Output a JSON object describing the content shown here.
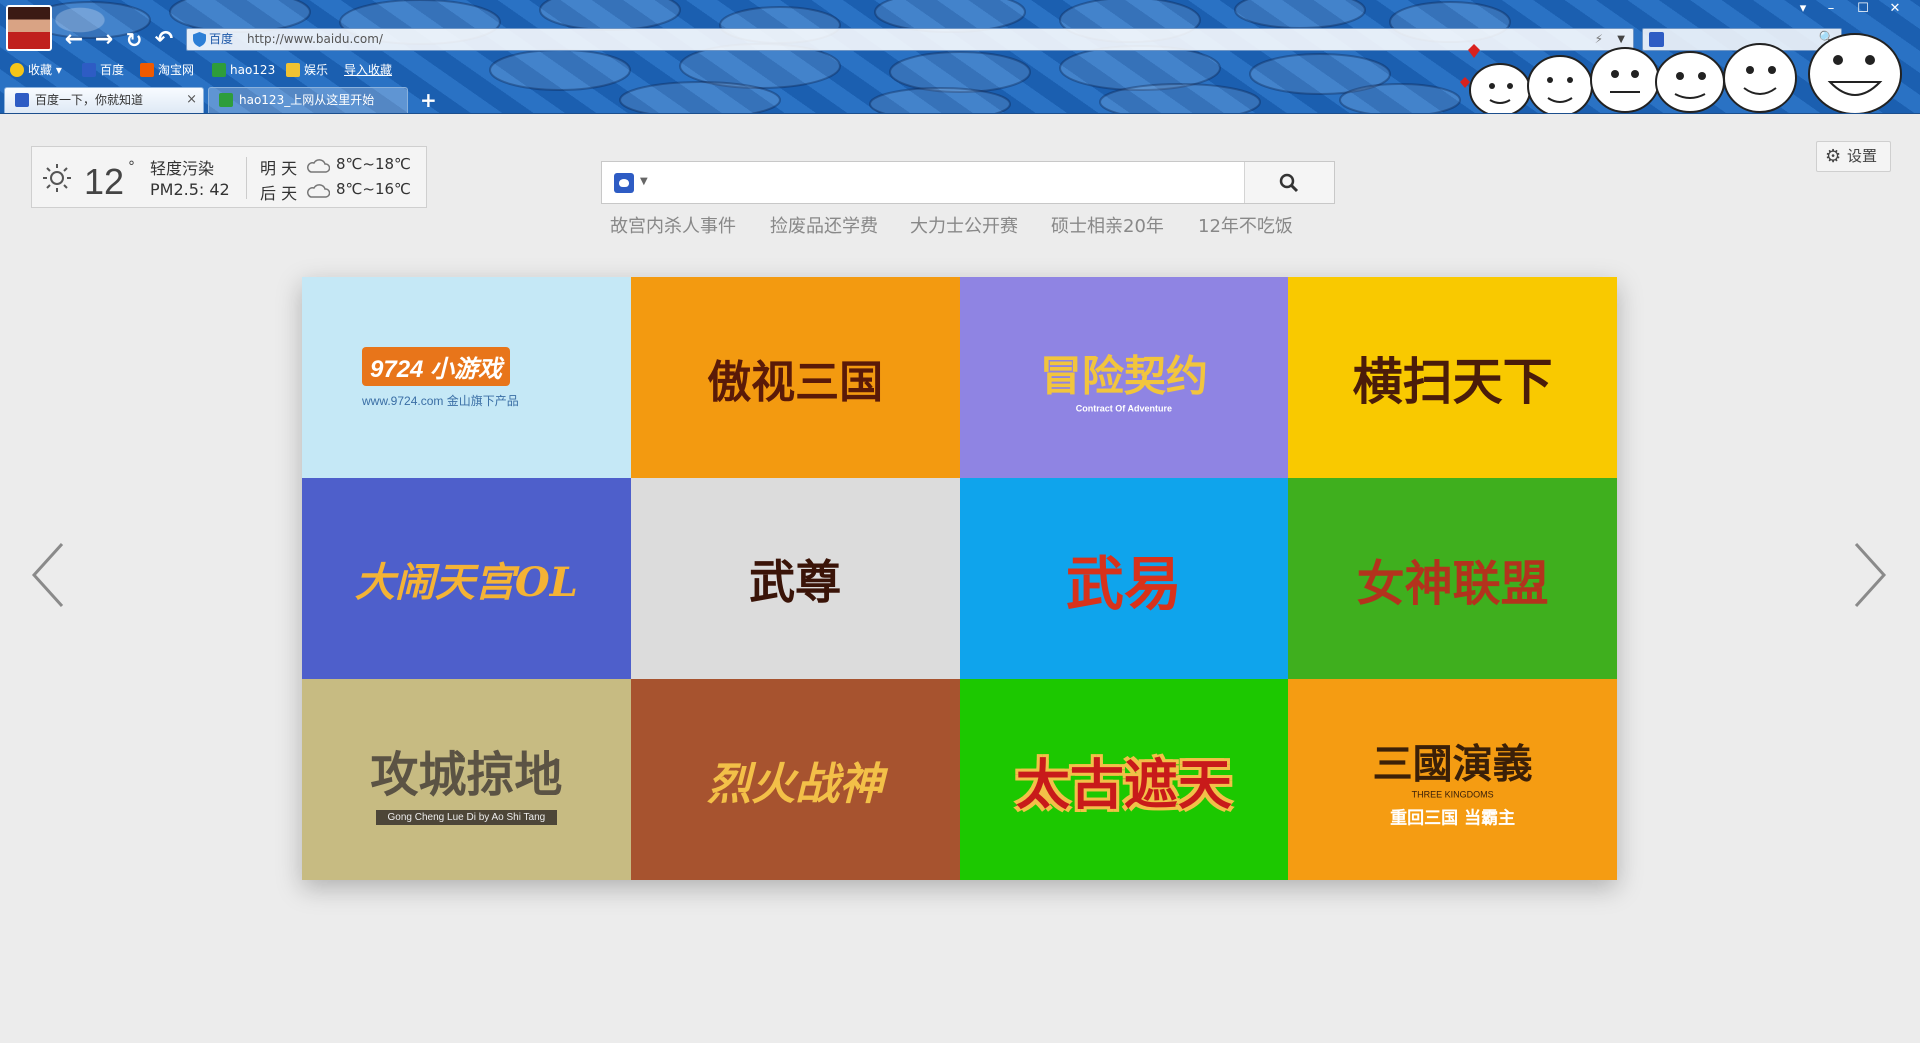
{
  "browser": {
    "address": {
      "site_label": "百度",
      "url": "http://www.baidu.com/"
    },
    "bookmarks": [
      {
        "label": "收藏",
        "color": "#f5c518"
      },
      {
        "label": "百度",
        "color": "#2e5cc4"
      },
      {
        "label": "淘宝网",
        "color": "#f05a00"
      },
      {
        "label": "hao123",
        "color": "#2e9d3b"
      },
      {
        "label": "娱乐",
        "color": "#f1c232"
      },
      {
        "label": "导入收藏",
        "color": ""
      }
    ],
    "tabs": [
      {
        "label": "百度一下，你就知道",
        "close": "×",
        "color": "#2e5cc4"
      },
      {
        "label": "hao123_上网从这里开始",
        "color": "#2e9d3b"
      }
    ],
    "new_tab": "+"
  },
  "weather": {
    "temp": "12",
    "deg": "°",
    "pollution": "轻度污染",
    "pm25": "PM2.5: 42",
    "day1": "明 天",
    "day1_range": "8℃~18℃",
    "day2": "后 天",
    "day2_range": "8℃~16℃"
  },
  "settings": {
    "label": "设置"
  },
  "search": {
    "placeholder": ""
  },
  "hot_searches": [
    "故宫内杀人事件",
    "捡废品还学费",
    "大力士公开赛",
    "硕士相亲20年",
    "12年不吃饭"
  ],
  "games": [
    {
      "title": "9724 小游戏",
      "subtitle": "www.9724.com 金山旗下产品",
      "bg": "#c5e8f6",
      "fg": "#e8751a"
    },
    {
      "title": "傲视三国",
      "subtitle": "",
      "bg": "#f39a10",
      "fg": "#5a1a08"
    },
    {
      "title": "冒险契约",
      "subtitle": "Contract Of Adventure",
      "bg": "#8f84e3",
      "fg": "#f2c53d"
    },
    {
      "title": "横扫天下",
      "subtitle": "",
      "bg": "#f9c900",
      "fg": "#4a1c0a"
    },
    {
      "title": "大闹天宫OL",
      "subtitle": "",
      "bg": "#4e5fcb",
      "fg": "#f4b335"
    },
    {
      "title": "武尊",
      "subtitle": "",
      "bg": "#dcdcdc",
      "fg": "#3a1408"
    },
    {
      "title": "武易",
      "subtitle": "",
      "bg": "#0fa4ec",
      "fg": "#d8321b"
    },
    {
      "title": "女神联盟",
      "subtitle": "",
      "bg": "#3faf1e",
      "fg": "#b3331d"
    },
    {
      "title": "攻城掠地",
      "subtitle": "Gong Cheng Lue Di by Ao Shi Tang",
      "bg": "#c7bb82",
      "fg": "#5b5344"
    },
    {
      "title": "烈火战神",
      "subtitle": "",
      "bg": "#a7532f",
      "fg": "#f3c048"
    },
    {
      "title": "太古遮天",
      "subtitle": "",
      "bg": "#1cc800",
      "fg": "#c81a1a"
    },
    {
      "title": "三國演義",
      "subtitle": "THREE KINGDOMS",
      "tagline": "重回三国 当霸主",
      "bg": "#f59c12",
      "fg": "#3b2008"
    }
  ]
}
